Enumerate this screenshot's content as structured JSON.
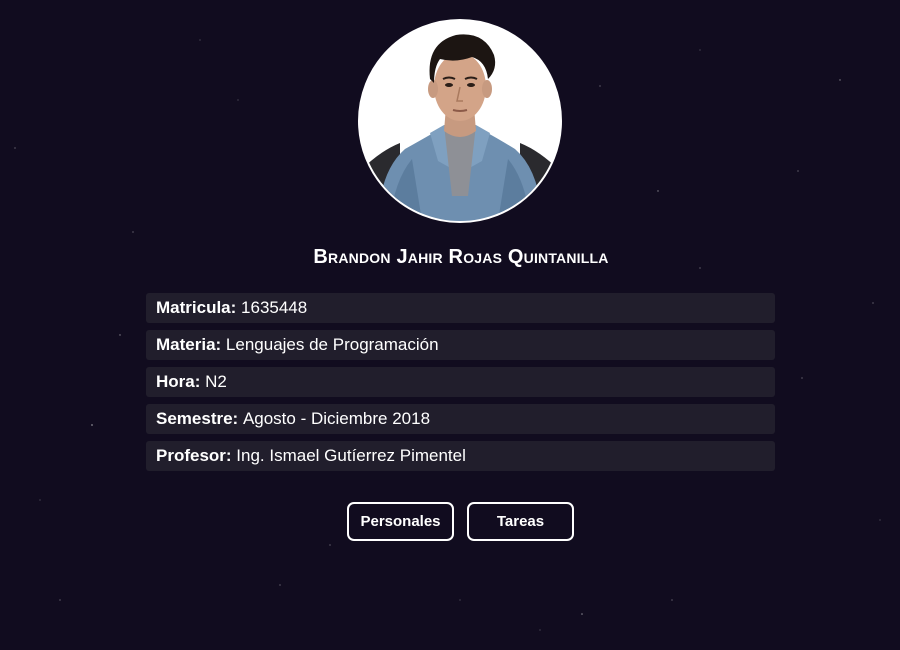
{
  "profile": {
    "name": "Brandon Jahir Rojas Quintanilla"
  },
  "info": [
    {
      "label": "Matricula:",
      "value": "1635448"
    },
    {
      "label": "Materia:",
      "value": "Lenguajes de Programación"
    },
    {
      "label": "Hora:",
      "value": "N2"
    },
    {
      "label": "Semestre:",
      "value": "Agosto - Diciembre 2018"
    },
    {
      "label": "Profesor:",
      "value": "Ing. Ismael Gutíerrez Pimentel"
    }
  ],
  "buttons": {
    "personales": "Personales",
    "tareas": "Tareas"
  },
  "colors": {
    "background": "#110c1f",
    "row_background": "#211e2c",
    "text": "#ffffff"
  }
}
